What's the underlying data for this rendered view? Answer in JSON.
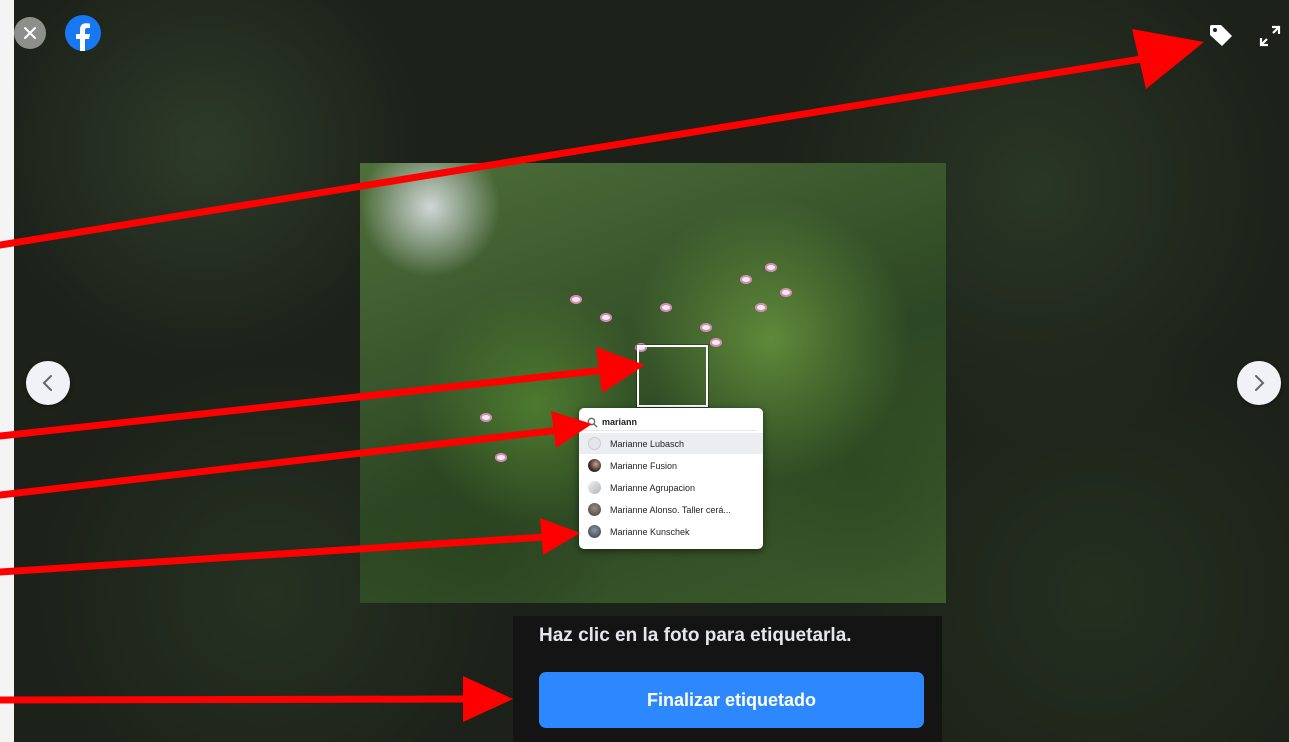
{
  "viewer": {
    "close_icon": "close-icon",
    "logo_icon": "facebook-logo-icon",
    "tag_icon": "tag-icon",
    "expand_icon": "expand-icon",
    "prev_icon": "chevron-left-icon",
    "next_icon": "chevron-right-icon"
  },
  "tagging": {
    "search_value": "mariann",
    "suggestions": [
      {
        "name": "Marianne Lubasch",
        "avatar": "default-avatar-icon"
      },
      {
        "name": "Marianne Fusion",
        "avatar": "avatar"
      },
      {
        "name": "Marianne Agrupacion",
        "avatar": "avatar"
      },
      {
        "name": "Marianne Alonso. Taller cerá...",
        "avatar": "avatar"
      },
      {
        "name": "Marianne Kunschek",
        "avatar": "avatar"
      }
    ]
  },
  "footer": {
    "hint": "Haz clic en la foto para etiquetarla.",
    "finish_label": "Finalizar etiquetado"
  },
  "colors": {
    "primary_button": "#2d88ff",
    "facebook_blue": "#1877f2",
    "annotation_arrow": "#ff0000"
  }
}
